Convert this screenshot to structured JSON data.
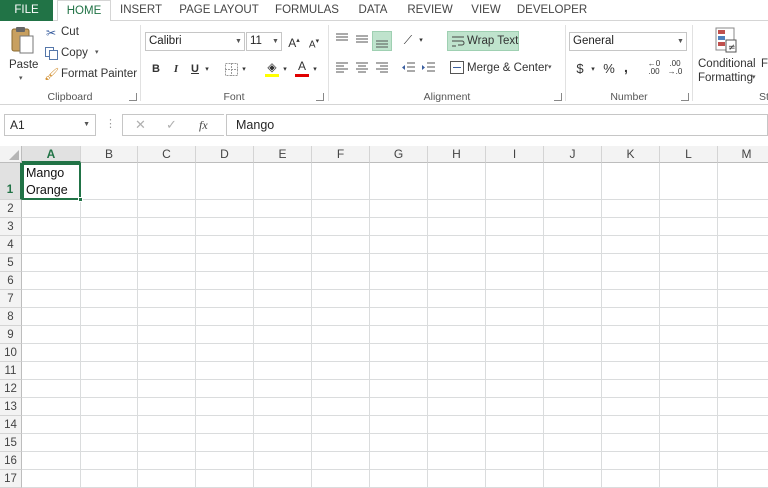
{
  "tabs": [
    "FILE",
    "HOME",
    "INSERT",
    "PAGE LAYOUT",
    "FORMULAS",
    "DATA",
    "REVIEW",
    "VIEW",
    "DEVELOPER"
  ],
  "active_tab": "HOME",
  "ribbon": {
    "clipboard": {
      "label": "Clipboard",
      "paste": "Paste",
      "cut": "Cut",
      "copy": "Copy",
      "format_painter": "Format Painter"
    },
    "font": {
      "label": "Font",
      "font_name": "Calibri",
      "font_size": "11",
      "bold": "B",
      "italic": "I",
      "underline": "U"
    },
    "alignment": {
      "label": "Alignment",
      "wrap_text": "Wrap Text",
      "merge_center": "Merge & Center"
    },
    "number": {
      "label": "Number",
      "format": "General",
      "currency": "$",
      "percent": "%",
      "comma": ","
    },
    "styles": {
      "conditional_formatting_line1": "Conditional",
      "conditional_formatting_line2": "Formatting",
      "label_partial": "St",
      "next_partial": "F"
    }
  },
  "formula_bar": {
    "name_box": "A1",
    "fx": "fx",
    "content": "Mango"
  },
  "sheet": {
    "columns": [
      "A",
      "B",
      "C",
      "D",
      "E",
      "F",
      "G",
      "H",
      "I",
      "J",
      "K",
      "L",
      "M"
    ],
    "rows": [
      "1",
      "2",
      "3",
      "4",
      "5",
      "6",
      "7",
      "8",
      "9",
      "10",
      "11",
      "12",
      "13",
      "14",
      "15",
      "16",
      "17"
    ],
    "selected_cell": "A1",
    "a1_line1": "Mango",
    "a1_line2": "Orange"
  },
  "colors": {
    "accent": "#217346",
    "wrap_highlight": "#bfe3cd",
    "header_bg": "#f3f3f3",
    "gridline": "#dadcdd"
  }
}
